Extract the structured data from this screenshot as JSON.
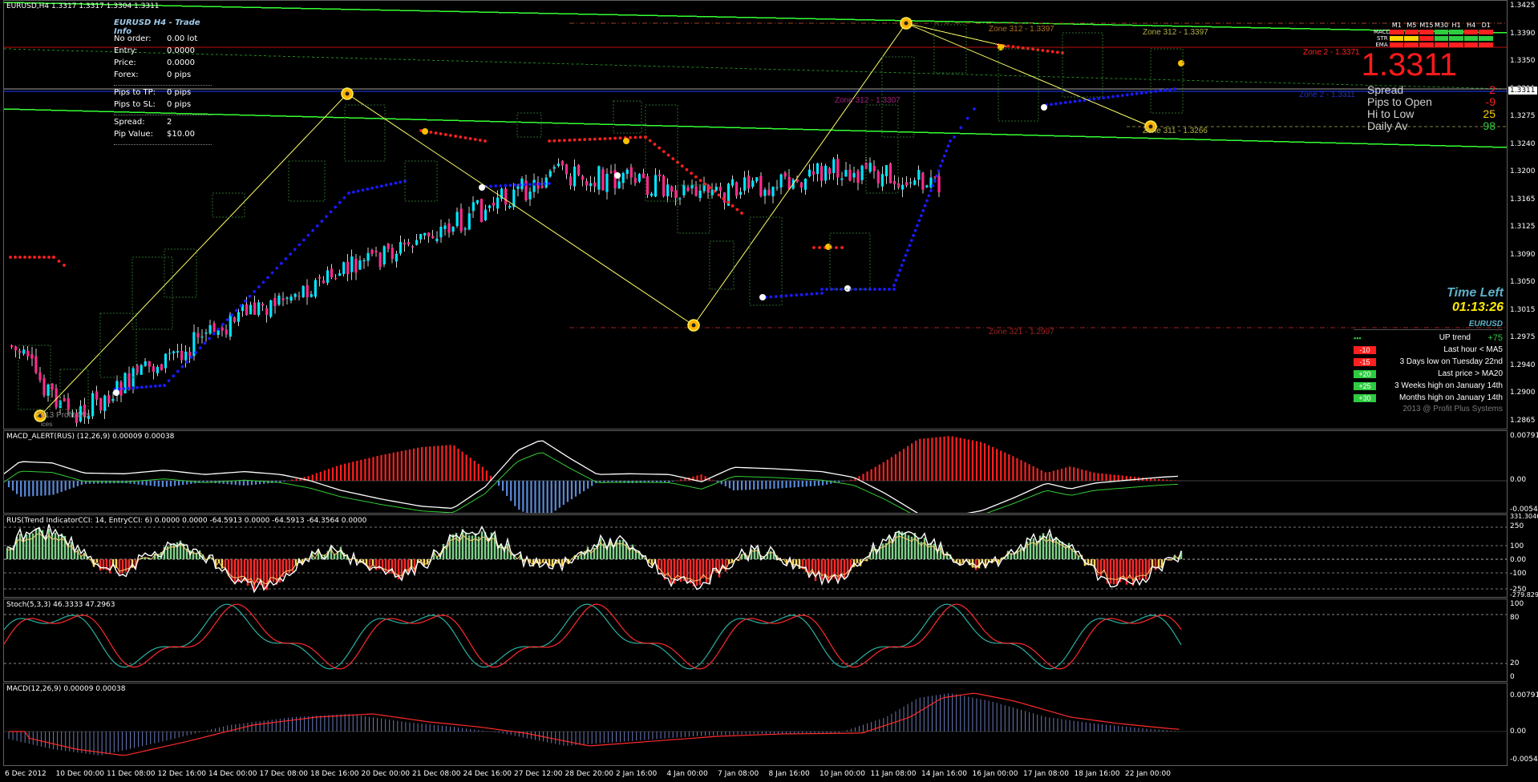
{
  "main": {
    "title": "EURUSD,H4  1.3317 1.3317 1.3304 1.3311",
    "price_axis": [
      "1.3425",
      "1.3390",
      "1.3350",
      "1.3311",
      "1.3275",
      "1.3240",
      "1.3200",
      "1.3165",
      "1.3125",
      "1.3090",
      "1.3050",
      "1.3015",
      "1.2975",
      "1.2940",
      "1.2900",
      "1.2865"
    ],
    "current_price_label": "1.3311",
    "watermark": "2013 Profit-Mts",
    "watermark2": "ices"
  },
  "trade_info": {
    "header": "EURUSD H4 - Trade Info",
    "rows": [
      {
        "k": "No order:",
        "v": "0.00 lot"
      },
      {
        "k": "Entry:",
        "v": "0.0000"
      },
      {
        "k": "Price:",
        "v": "0.0000"
      },
      {
        "k": "Forex:",
        "v": "0 pips"
      }
    ],
    "rows2": [
      {
        "k": "Pips to TP:",
        "v": "0 pips"
      },
      {
        "k": "Pips to SL:",
        "v": "0 pips"
      }
    ],
    "rows3": [
      {
        "k": "Spread:",
        "v": "2"
      },
      {
        "k": "Pip Value:",
        "v": "$10.00"
      }
    ]
  },
  "dashboard": {
    "mtf_headers": [
      "M1",
      "M5",
      "M15",
      "M30",
      "H1",
      "H4",
      "D1"
    ],
    "mtf_rows": [
      {
        "label": "MACD",
        "colors": [
          "#ff2020",
          "#ff2020",
          "#ff2020",
          "#2ecc40",
          "#2ecc40",
          "#ff2020",
          "#ff2020"
        ]
      },
      {
        "label": "STR",
        "colors": [
          "#ffd400",
          "#ffd400",
          "#ff2020",
          "#2ecc40",
          "#2ecc40",
          "#2ecc40",
          "#2ecc40"
        ]
      },
      {
        "label": "EMA",
        "colors": [
          "#ff2020",
          "#ff2020",
          "#ff2020",
          "#ff2020",
          "#ff2020",
          "#ff2020",
          "#ff2020"
        ]
      }
    ],
    "big_price": "1.3311",
    "stats": [
      {
        "label": "Spread",
        "value": "2",
        "color": "#ff2020"
      },
      {
        "label": "Pips to Open",
        "value": "-9",
        "color": "#ff2020"
      },
      {
        "label": "Hi to Low",
        "value": "25",
        "color": "#ffd400"
      },
      {
        "label": "Daily Av",
        "value": "98",
        "color": "#2ecc40"
      }
    ],
    "time_left_label": "Time Left",
    "time_left_value": "01:13:26",
    "trend_symbol": "EURUSD",
    "trend_summary_label": "UP trend",
    "trend_summary_value": "+75",
    "trend_rows": [
      {
        "badge": "-10",
        "badge_color": "#ff2020",
        "text": "Last hour < MA5"
      },
      {
        "badge": "-15",
        "badge_color": "#ff2020",
        "text": "3 Days low on Tuesday 22nd"
      },
      {
        "badge": "+20",
        "badge_color": "#2ecc40",
        "text": "Last price > MA20"
      },
      {
        "badge": "+25",
        "badge_color": "#2ecc40",
        "text": "3 Weeks high on January 14th"
      },
      {
        "badge": "+30",
        "badge_color": "#2ecc40",
        "text": "Months high on January 14th"
      }
    ],
    "copyright": "2013 @ Profit Plus Systems"
  },
  "zones": [
    {
      "text": "Zone 312 - 1.3397",
      "color": "#b07020"
    },
    {
      "text": "Zone 2 - 1.3371",
      "color": "#ff2020"
    },
    {
      "text": "Zone 312 - 1.3397",
      "color": "#b0b040"
    },
    {
      "text": "Zone 312 - 1.3307",
      "color": "#a02080"
    },
    {
      "text": "Zone 2 - 1.3311",
      "color": "#2030c0"
    },
    {
      "text": "Zone 311 - 1.3266",
      "color": "#b0b040"
    },
    {
      "text": "Zone 321 - 1.2997",
      "color": "#a02020"
    }
  ],
  "macd_alert": {
    "title": "MACD_ALERT(RUS) (12,26,9)  0.00009 0.00038",
    "axis": [
      "0.00791",
      "0.00",
      "-0.00547"
    ]
  },
  "cci": {
    "title": "RUS(Trend IndicatorCCI: 14, EntryCCI: 6)  0.0000 0.0000 -64.5913 0.0000 -64.5913 -64.3564 0.0000",
    "axis": [
      "331.3046",
      "250",
      "100",
      "0.00",
      "-100",
      "-250",
      "-279.829"
    ]
  },
  "stoch": {
    "title": "Stoch(5,3,3) 46.3333 47.2963",
    "axis": [
      "100",
      "80",
      "20",
      "0"
    ]
  },
  "macd": {
    "title": "MACD(12,26,9) 0.00009 0.00038",
    "axis": [
      "0.00791",
      "0.00",
      "-0.00547"
    ]
  },
  "time_axis": [
    "6 Dec 2012",
    "10 Dec 00:00",
    "11 Dec 08:00",
    "12 Dec 16:00",
    "14 Dec 00:00",
    "17 Dec 08:00",
    "18 Dec 16:00",
    "20 Dec 00:00",
    "21 Dec 08:00",
    "24 Dec 16:00",
    "27 Dec 12:00",
    "28 Dec 20:00",
    "2 Jan 16:00",
    "4 Jan 00:00",
    "7 Jan 08:00",
    "8 Jan 16:00",
    "10 Jan 00:00",
    "11 Jan 08:00",
    "14 Jan 16:00",
    "16 Jan 00:00",
    "17 Jan 08:00",
    "18 Jan 16:00",
    "22 Jan 00:00"
  ],
  "colors": {
    "bull": "#00e5ff",
    "bear": "#ff2a8a",
    "channel": "#33ff33",
    "zigzag": "#ffff66",
    "sar_bull": "#1a1aff",
    "sar_bear": "#ff2020"
  }
}
